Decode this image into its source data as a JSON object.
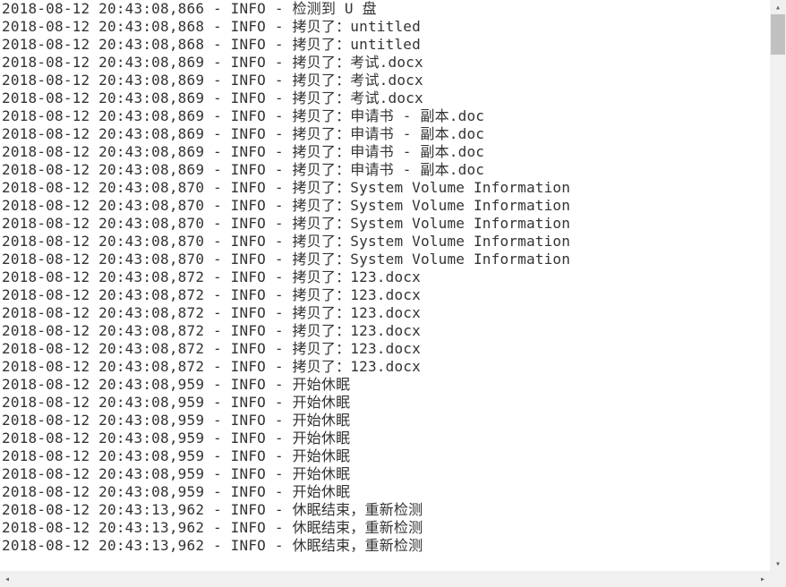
{
  "logs": [
    {
      "timestamp": "2018-08-12 20:43:08,866",
      "level": "INFO",
      "message": "检测到 U 盘"
    },
    {
      "timestamp": "2018-08-12 20:43:08,868",
      "level": "INFO",
      "message": "拷贝了：untitled"
    },
    {
      "timestamp": "2018-08-12 20:43:08,868",
      "level": "INFO",
      "message": "拷贝了：untitled"
    },
    {
      "timestamp": "2018-08-12 20:43:08,869",
      "level": "INFO",
      "message": "拷贝了：考试.docx"
    },
    {
      "timestamp": "2018-08-12 20:43:08,869",
      "level": "INFO",
      "message": "拷贝了：考试.docx"
    },
    {
      "timestamp": "2018-08-12 20:43:08,869",
      "level": "INFO",
      "message": "拷贝了：考试.docx"
    },
    {
      "timestamp": "2018-08-12 20:43:08,869",
      "level": "INFO",
      "message": "拷贝了：申请书 - 副本.doc"
    },
    {
      "timestamp": "2018-08-12 20:43:08,869",
      "level": "INFO",
      "message": "拷贝了：申请书 - 副本.doc"
    },
    {
      "timestamp": "2018-08-12 20:43:08,869",
      "level": "INFO",
      "message": "拷贝了：申请书 - 副本.doc"
    },
    {
      "timestamp": "2018-08-12 20:43:08,869",
      "level": "INFO",
      "message": "拷贝了：申请书 - 副本.doc"
    },
    {
      "timestamp": "2018-08-12 20:43:08,870",
      "level": "INFO",
      "message": "拷贝了：System Volume Information"
    },
    {
      "timestamp": "2018-08-12 20:43:08,870",
      "level": "INFO",
      "message": "拷贝了：System Volume Information"
    },
    {
      "timestamp": "2018-08-12 20:43:08,870",
      "level": "INFO",
      "message": "拷贝了：System Volume Information"
    },
    {
      "timestamp": "2018-08-12 20:43:08,870",
      "level": "INFO",
      "message": "拷贝了：System Volume Information"
    },
    {
      "timestamp": "2018-08-12 20:43:08,870",
      "level": "INFO",
      "message": "拷贝了：System Volume Information"
    },
    {
      "timestamp": "2018-08-12 20:43:08,872",
      "level": "INFO",
      "message": "拷贝了：123.docx"
    },
    {
      "timestamp": "2018-08-12 20:43:08,872",
      "level": "INFO",
      "message": "拷贝了：123.docx"
    },
    {
      "timestamp": "2018-08-12 20:43:08,872",
      "level": "INFO",
      "message": "拷贝了：123.docx"
    },
    {
      "timestamp": "2018-08-12 20:43:08,872",
      "level": "INFO",
      "message": "拷贝了：123.docx"
    },
    {
      "timestamp": "2018-08-12 20:43:08,872",
      "level": "INFO",
      "message": "拷贝了：123.docx"
    },
    {
      "timestamp": "2018-08-12 20:43:08,872",
      "level": "INFO",
      "message": "拷贝了：123.docx"
    },
    {
      "timestamp": "2018-08-12 20:43:08,959",
      "level": "INFO",
      "message": "开始休眠"
    },
    {
      "timestamp": "2018-08-12 20:43:08,959",
      "level": "INFO",
      "message": "开始休眠"
    },
    {
      "timestamp": "2018-08-12 20:43:08,959",
      "level": "INFO",
      "message": "开始休眠"
    },
    {
      "timestamp": "2018-08-12 20:43:08,959",
      "level": "INFO",
      "message": "开始休眠"
    },
    {
      "timestamp": "2018-08-12 20:43:08,959",
      "level": "INFO",
      "message": "开始休眠"
    },
    {
      "timestamp": "2018-08-12 20:43:08,959",
      "level": "INFO",
      "message": "开始休眠"
    },
    {
      "timestamp": "2018-08-12 20:43:08,959",
      "level": "INFO",
      "message": "开始休眠"
    },
    {
      "timestamp": "2018-08-12 20:43:13,962",
      "level": "INFO",
      "message": "休眠结束，重新检测"
    },
    {
      "timestamp": "2018-08-12 20:43:13,962",
      "level": "INFO",
      "message": "休眠结束，重新检测"
    },
    {
      "timestamp": "2018-08-12 20:43:13,962",
      "level": "INFO",
      "message": "休眠结束，重新检测"
    }
  ]
}
